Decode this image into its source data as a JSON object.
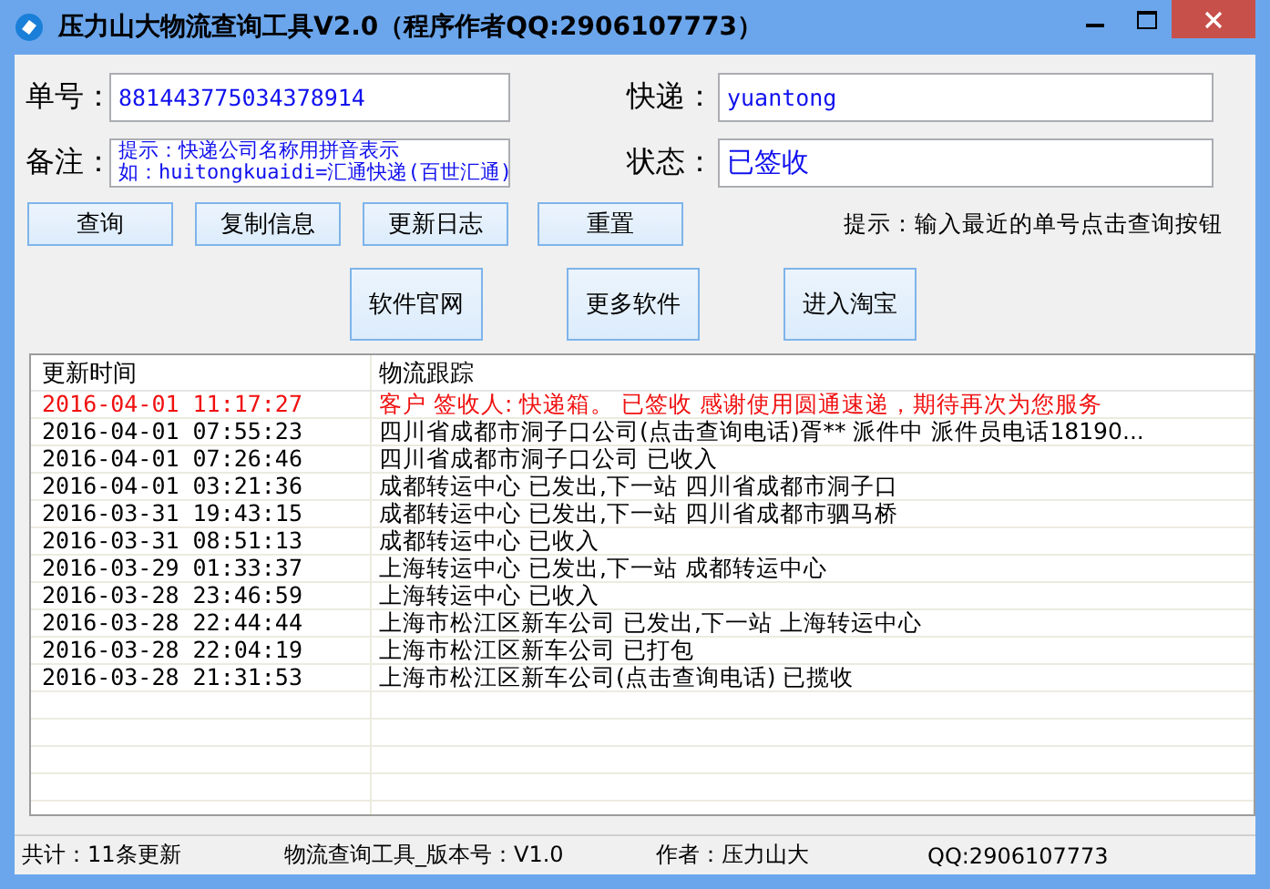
{
  "window": {
    "title": "压力山大物流查询工具V2.0（程序作者QQ:2906107773）"
  },
  "fields": [
    {
      "label": "单号：",
      "value": "881443775034378914",
      "kind": "single"
    },
    {
      "label": "快递：",
      "value": "yuantong",
      "kind": "single"
    },
    {
      "label": "备注：",
      "lines": [
        "提示：快递公司名称用拼音表示",
        "如：huitongkuaidi=汇通快递(百世汇通)"
      ],
      "kind": "multi"
    },
    {
      "label": "状态：",
      "value": "已签收",
      "kind": "large"
    }
  ],
  "buttons": [
    "查询",
    "复制信息",
    "更新日志",
    "重置"
  ],
  "hint": "提示：输入最近的单号点击查询按钮",
  "link_buttons": [
    "软件官网",
    "更多软件",
    "进入淘宝"
  ],
  "table": {
    "columns": [
      "更新时间",
      "物流跟踪"
    ],
    "rows": [
      {
        "time": "2016-04-01 11:17:27",
        "track": "客户 签收人: 快递箱。 已签收  感谢使用圆通速递，期待再次为您服务",
        "highlighted": true
      },
      {
        "time": "2016-04-01 07:55:23",
        "track": "四川省成都市洞子口公司(点击查询电话)胥** 派件中 派件员电话18190...",
        "highlighted": false
      },
      {
        "time": "2016-04-01 07:26:46",
        "track": "四川省成都市洞子口公司 已收入",
        "highlighted": false
      },
      {
        "time": "2016-04-01 03:21:36",
        "track": "成都转运中心 已发出,下一站 四川省成都市洞子口",
        "highlighted": false
      },
      {
        "time": "2016-03-31 19:43:15",
        "track": "成都转运中心 已发出,下一站 四川省成都市驷马桥",
        "highlighted": false
      },
      {
        "time": "2016-03-31 08:51:13",
        "track": "成都转运中心 已收入",
        "highlighted": false
      },
      {
        "time": "2016-03-29 01:33:37",
        "track": "上海转运中心 已发出,下一站 成都转运中心",
        "highlighted": false
      },
      {
        "time": "2016-03-28 23:46:59",
        "track": "上海转运中心 已收入",
        "highlighted": false
      },
      {
        "time": "2016-03-28 22:44:44",
        "track": "上海市松江区新车公司 已发出,下一站 上海转运中心",
        "highlighted": false
      },
      {
        "time": "2016-03-28 22:04:19",
        "track": "上海市松江区新车公司 已打包",
        "highlighted": false
      },
      {
        "time": "2016-03-28 21:31:53",
        "track": "上海市松江区新车公司(点击查询电话) 已揽收",
        "highlighted": false
      }
    ]
  },
  "status_bar": [
    "共计：11条更新",
    "物流查询工具_版本号：V1.0",
    "作者：压力山大",
    "QQ:2906107773"
  ]
}
